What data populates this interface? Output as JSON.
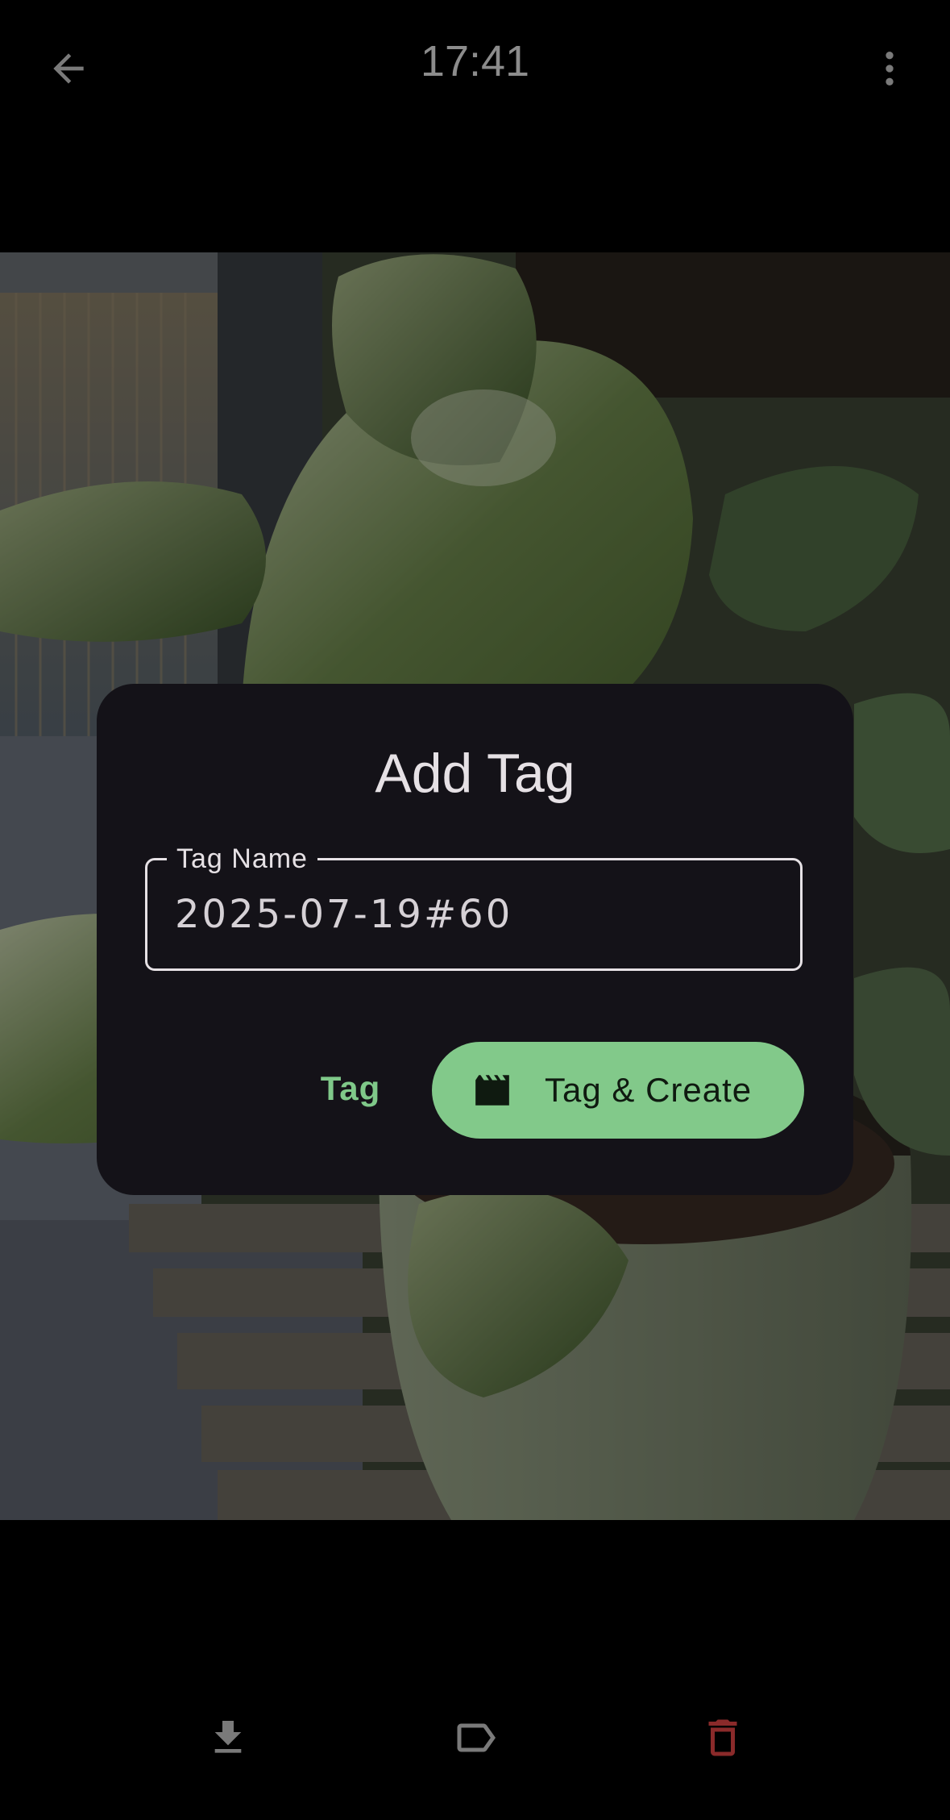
{
  "header": {
    "title": "17:41",
    "back_icon": "arrow-back-icon",
    "menu_icon": "more-vert-icon"
  },
  "photo": {
    "subject": "plant-photo"
  },
  "dialog": {
    "title": "Add Tag",
    "field_label": "Tag Name",
    "field_value": "2025-07-19#60",
    "tag_button_label": "Tag",
    "create_button_label": "Tag & Create",
    "create_button_icon": "clapperboard-icon"
  },
  "bottom_bar": {
    "download_icon": "download-icon",
    "tag_icon": "label-icon",
    "delete_icon": "delete-icon"
  },
  "colors": {
    "accent": "#82c98a",
    "dialog_bg": "#141218",
    "delete": "#8a2a2a"
  }
}
